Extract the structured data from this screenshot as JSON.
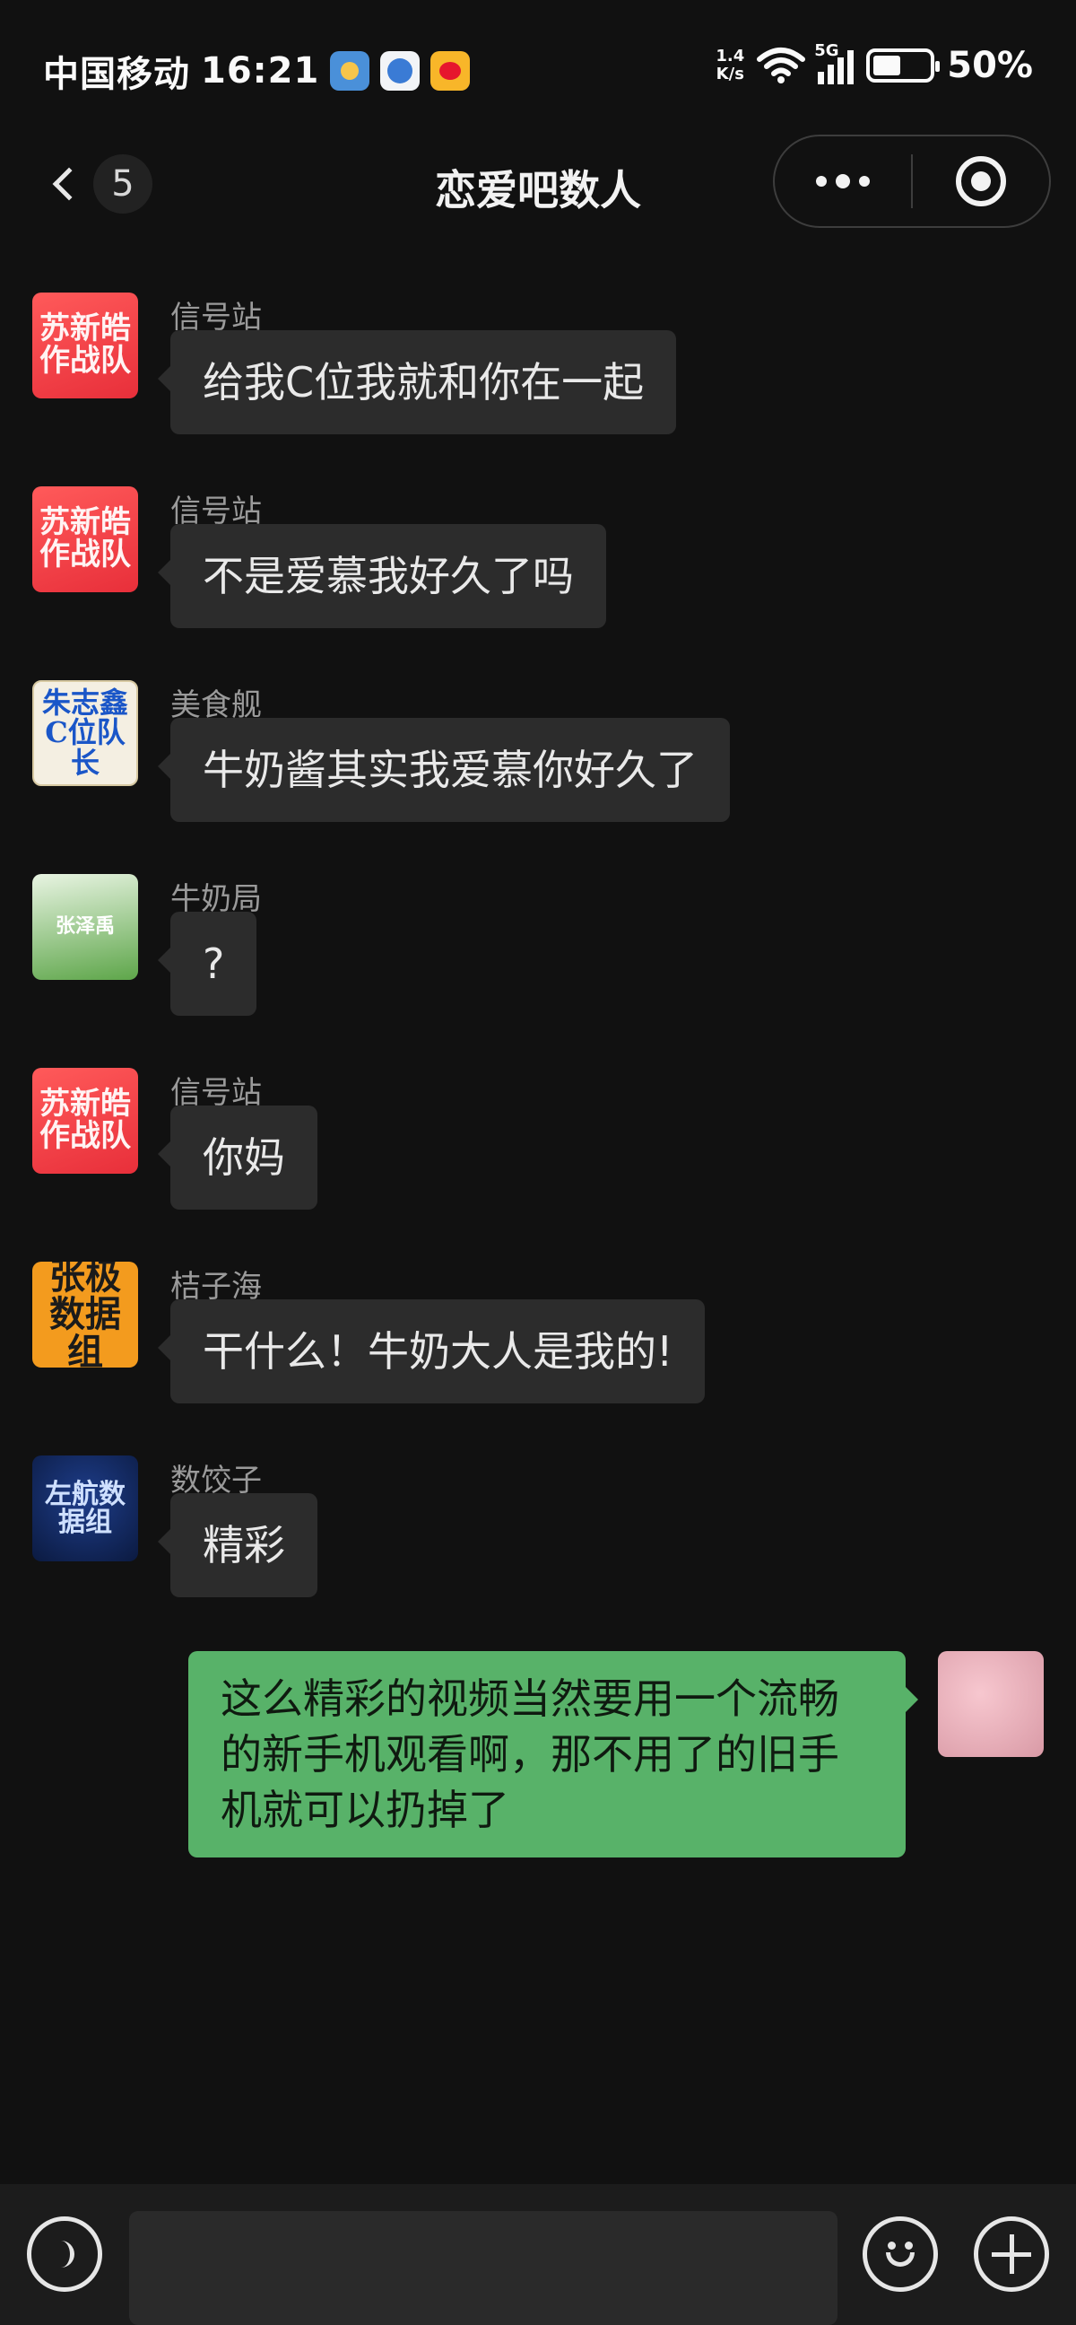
{
  "status_bar": {
    "carrier": "中国移动",
    "time": "16:21",
    "net_speed_value": "1.4",
    "net_speed_unit": "K/s",
    "network_type": "5G",
    "battery_level": 0.5,
    "battery_text": "50%",
    "notification_icons": [
      "weather-app-icon",
      "browser-app-icon",
      "weibo-app-icon"
    ]
  },
  "header": {
    "unread_count": "5",
    "title": "恋爱吧数人"
  },
  "messages": [
    {
      "sender": "信号站",
      "text": "给我C位我就和你在一起",
      "avatar_text": "苏新皓作战队",
      "avatar_style": "red"
    },
    {
      "sender": "信号站",
      "text": "不是爱慕我好久了吗",
      "avatar_text": "苏新皓作战队",
      "avatar_style": "red"
    },
    {
      "sender": "美食舰",
      "text": "牛奶酱其实我爱慕你好久了",
      "avatar_text": "朱志鑫C位队长",
      "avatar_style": "cream"
    },
    {
      "sender": "牛奶局",
      "text": "?",
      "avatar_text": "张泽禹",
      "avatar_style": "green"
    },
    {
      "sender": "信号站",
      "text": "你妈",
      "avatar_text": "苏新皓作战队",
      "avatar_style": "red"
    },
    {
      "sender": "桔子海",
      "text": "干什么！牛奶大人是我的!",
      "avatar_text": "张极数据组",
      "avatar_style": "orange"
    },
    {
      "sender": "数饺子",
      "text": "精彩",
      "avatar_text": "左航数据组",
      "avatar_style": "navy"
    }
  ],
  "own_message": {
    "text": "这么精彩的视频当然要用一个流畅的新手机观看啊，那不用了的旧手机就可以扔掉了"
  },
  "colors": {
    "background": "#111111",
    "incoming_bubble": "#2c2c2c",
    "outgoing_bubble": "#58b269",
    "sender_text": "#9a9a9a"
  }
}
